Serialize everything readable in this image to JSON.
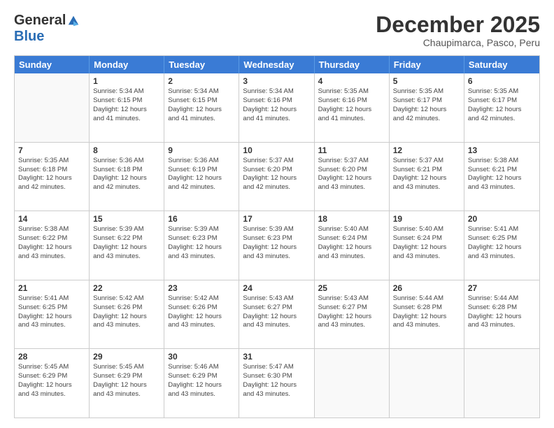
{
  "logo": {
    "general": "General",
    "blue": "Blue"
  },
  "title": "December 2025",
  "subtitle": "Chaupimarca, Pasco, Peru",
  "days": [
    "Sunday",
    "Monday",
    "Tuesday",
    "Wednesday",
    "Thursday",
    "Friday",
    "Saturday"
  ],
  "weeks": [
    [
      {
        "day": "",
        "info": ""
      },
      {
        "day": "1",
        "info": "Sunrise: 5:34 AM\nSunset: 6:15 PM\nDaylight: 12 hours\nand 41 minutes."
      },
      {
        "day": "2",
        "info": "Sunrise: 5:34 AM\nSunset: 6:15 PM\nDaylight: 12 hours\nand 41 minutes."
      },
      {
        "day": "3",
        "info": "Sunrise: 5:34 AM\nSunset: 6:16 PM\nDaylight: 12 hours\nand 41 minutes."
      },
      {
        "day": "4",
        "info": "Sunrise: 5:35 AM\nSunset: 6:16 PM\nDaylight: 12 hours\nand 41 minutes."
      },
      {
        "day": "5",
        "info": "Sunrise: 5:35 AM\nSunset: 6:17 PM\nDaylight: 12 hours\nand 42 minutes."
      },
      {
        "day": "6",
        "info": "Sunrise: 5:35 AM\nSunset: 6:17 PM\nDaylight: 12 hours\nand 42 minutes."
      }
    ],
    [
      {
        "day": "7",
        "info": "Sunrise: 5:35 AM\nSunset: 6:18 PM\nDaylight: 12 hours\nand 42 minutes."
      },
      {
        "day": "8",
        "info": "Sunrise: 5:36 AM\nSunset: 6:18 PM\nDaylight: 12 hours\nand 42 minutes."
      },
      {
        "day": "9",
        "info": "Sunrise: 5:36 AM\nSunset: 6:19 PM\nDaylight: 12 hours\nand 42 minutes."
      },
      {
        "day": "10",
        "info": "Sunrise: 5:37 AM\nSunset: 6:20 PM\nDaylight: 12 hours\nand 42 minutes."
      },
      {
        "day": "11",
        "info": "Sunrise: 5:37 AM\nSunset: 6:20 PM\nDaylight: 12 hours\nand 43 minutes."
      },
      {
        "day": "12",
        "info": "Sunrise: 5:37 AM\nSunset: 6:21 PM\nDaylight: 12 hours\nand 43 minutes."
      },
      {
        "day": "13",
        "info": "Sunrise: 5:38 AM\nSunset: 6:21 PM\nDaylight: 12 hours\nand 43 minutes."
      }
    ],
    [
      {
        "day": "14",
        "info": "Sunrise: 5:38 AM\nSunset: 6:22 PM\nDaylight: 12 hours\nand 43 minutes."
      },
      {
        "day": "15",
        "info": "Sunrise: 5:39 AM\nSunset: 6:22 PM\nDaylight: 12 hours\nand 43 minutes."
      },
      {
        "day": "16",
        "info": "Sunrise: 5:39 AM\nSunset: 6:23 PM\nDaylight: 12 hours\nand 43 minutes."
      },
      {
        "day": "17",
        "info": "Sunrise: 5:39 AM\nSunset: 6:23 PM\nDaylight: 12 hours\nand 43 minutes."
      },
      {
        "day": "18",
        "info": "Sunrise: 5:40 AM\nSunset: 6:24 PM\nDaylight: 12 hours\nand 43 minutes."
      },
      {
        "day": "19",
        "info": "Sunrise: 5:40 AM\nSunset: 6:24 PM\nDaylight: 12 hours\nand 43 minutes."
      },
      {
        "day": "20",
        "info": "Sunrise: 5:41 AM\nSunset: 6:25 PM\nDaylight: 12 hours\nand 43 minutes."
      }
    ],
    [
      {
        "day": "21",
        "info": "Sunrise: 5:41 AM\nSunset: 6:25 PM\nDaylight: 12 hours\nand 43 minutes."
      },
      {
        "day": "22",
        "info": "Sunrise: 5:42 AM\nSunset: 6:26 PM\nDaylight: 12 hours\nand 43 minutes."
      },
      {
        "day": "23",
        "info": "Sunrise: 5:42 AM\nSunset: 6:26 PM\nDaylight: 12 hours\nand 43 minutes."
      },
      {
        "day": "24",
        "info": "Sunrise: 5:43 AM\nSunset: 6:27 PM\nDaylight: 12 hours\nand 43 minutes."
      },
      {
        "day": "25",
        "info": "Sunrise: 5:43 AM\nSunset: 6:27 PM\nDaylight: 12 hours\nand 43 minutes."
      },
      {
        "day": "26",
        "info": "Sunrise: 5:44 AM\nSunset: 6:28 PM\nDaylight: 12 hours\nand 43 minutes."
      },
      {
        "day": "27",
        "info": "Sunrise: 5:44 AM\nSunset: 6:28 PM\nDaylight: 12 hours\nand 43 minutes."
      }
    ],
    [
      {
        "day": "28",
        "info": "Sunrise: 5:45 AM\nSunset: 6:29 PM\nDaylight: 12 hours\nand 43 minutes."
      },
      {
        "day": "29",
        "info": "Sunrise: 5:45 AM\nSunset: 6:29 PM\nDaylight: 12 hours\nand 43 minutes."
      },
      {
        "day": "30",
        "info": "Sunrise: 5:46 AM\nSunset: 6:29 PM\nDaylight: 12 hours\nand 43 minutes."
      },
      {
        "day": "31",
        "info": "Sunrise: 5:47 AM\nSunset: 6:30 PM\nDaylight: 12 hours\nand 43 minutes."
      },
      {
        "day": "",
        "info": ""
      },
      {
        "day": "",
        "info": ""
      },
      {
        "day": "",
        "info": ""
      }
    ]
  ]
}
